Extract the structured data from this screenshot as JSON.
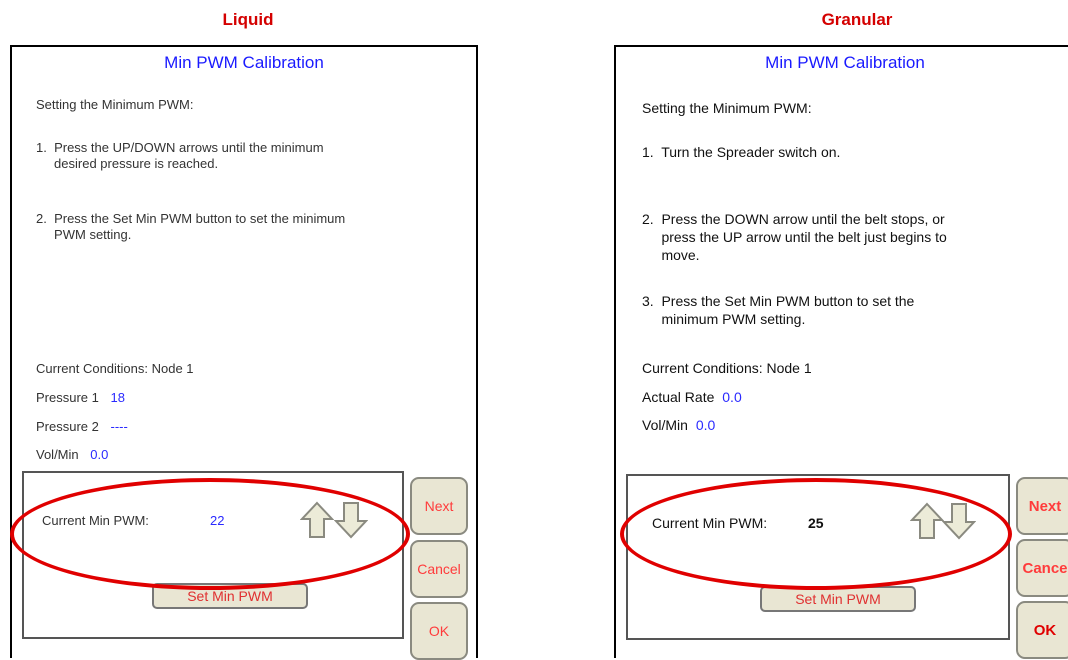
{
  "liquid": {
    "heading": "Liquid",
    "title": "Min PWM Calibration",
    "subtitle": "Setting the Minimum PWM:",
    "step1": "1.  Press the UP/DOWN arrows until the minimum\n     desired pressure is reached.",
    "step2": "2.  Press the Set Min PWM button to set the minimum\n     PWM setting.",
    "conditions": "Current Conditions: Node 1",
    "p1_label": "Pressure 1",
    "p1_value": "18",
    "p2_label": "Pressure 2",
    "p2_value": "----",
    "vol_label": "Vol/Min",
    "vol_value": "0.0",
    "pwm_label": "Current Min PWM:",
    "pwm_value": "22",
    "set_button": "Set Min PWM",
    "next": "Next",
    "cancel": "Cancel",
    "ok": "OK"
  },
  "granular": {
    "heading": "Granular",
    "title": "Min PWM Calibration",
    "subtitle": "Setting the Minimum PWM:",
    "step1": "1.  Turn the Spreader switch on.",
    "step2": "2.  Press the DOWN arrow until the belt stops, or\n     press the UP arrow until the belt just begins to\n     move.",
    "step3": "3.  Press the Set Min PWM button to set the\n     minimum PWM setting.",
    "conditions": "Current Conditions: Node 1",
    "rate_label": "Actual Rate",
    "rate_value": "0.0",
    "vol_label": "Vol/Min",
    "vol_value": "0.0",
    "pwm_label": "Current Min PWM:",
    "pwm_value": "25",
    "set_button": "Set Min PWM",
    "next": "Next",
    "cancel": "Cance",
    "ok": "OK"
  },
  "colors": {
    "heading": "#d40000",
    "title": "#1a1aff",
    "value": "#2a2aff",
    "button_text": "#ff3b3b",
    "highlight": "#e00000"
  },
  "icons": [
    "up-arrow-icon",
    "down-arrow-icon"
  ]
}
